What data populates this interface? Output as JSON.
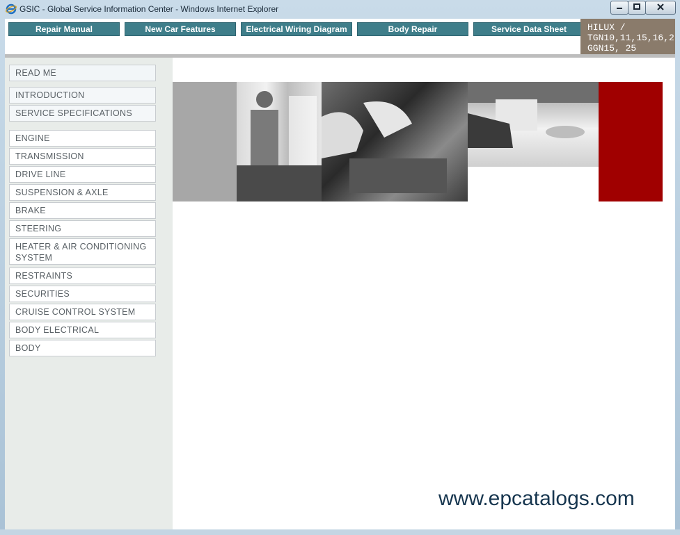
{
  "window": {
    "title": "GSIC - Global Service Information Center - Windows Internet Explorer"
  },
  "nav": {
    "tabs": [
      {
        "label": "Repair Manual"
      },
      {
        "label": "New Car Features"
      },
      {
        "label": "Electrical Wiring Diagram"
      },
      {
        "label": "Body Repair"
      },
      {
        "label": "Service Data Sheet"
      }
    ]
  },
  "model": {
    "line1": "HILUX /",
    "line2": "TGN10,11,15,16,2",
    "line3": "GGN15, 25"
  },
  "sidebar": {
    "items": [
      {
        "label": "READ ME"
      },
      {
        "label": "INTRODUCTION"
      },
      {
        "label": "SERVICE SPECIFICATIONS"
      },
      {
        "label": "ENGINE"
      },
      {
        "label": "TRANSMISSION"
      },
      {
        "label": "DRIVE LINE"
      },
      {
        "label": "SUSPENSION & AXLE"
      },
      {
        "label": "BRAKE"
      },
      {
        "label": "STEERING"
      },
      {
        "label": "HEATER & AIR CONDITIONING SYSTEM"
      },
      {
        "label": "RESTRAINTS"
      },
      {
        "label": "SECURITIES"
      },
      {
        "label": "CRUISE CONTROL SYSTEM"
      },
      {
        "label": "BODY ELECTRICAL"
      },
      {
        "label": "BODY"
      }
    ]
  },
  "watermark": "www.epcatalogs.com",
  "colors": {
    "tab_bg": "#3f7e8a",
    "model_bg": "#8a7b6b",
    "banner_red": "#a00000",
    "banner_gray": "#a7a7a7",
    "sidebar_bg": "#e8ece9"
  },
  "icons": {
    "app": "ie-icon",
    "minimize": "minimize-icon",
    "maximize": "maximize-icon",
    "close": "close-icon"
  }
}
